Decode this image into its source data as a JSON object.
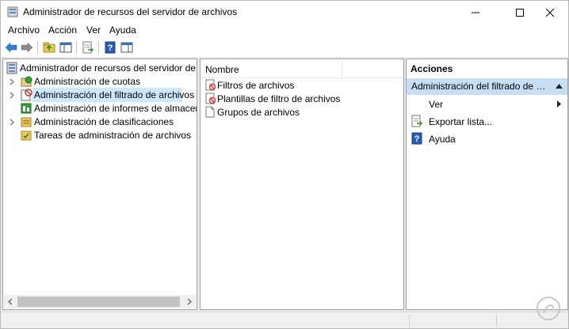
{
  "window": {
    "title": "Administrador de recursos del servidor de archivos",
    "controls": [
      "minimize-icon",
      "maximize-icon",
      "close-icon"
    ]
  },
  "menu": {
    "items": [
      "Archivo",
      "Acción",
      "Ver",
      "Ayuda"
    ]
  },
  "toolbar": {
    "buttons": [
      "back-icon",
      "forward-icon",
      "up-folder-icon",
      "show-hide-tree-icon",
      "export-list-icon",
      "help-icon",
      "show-hide-action-pane-icon"
    ]
  },
  "tree": {
    "root": "Administrador de recursos del servidor de archivos",
    "items": [
      {
        "label": "Administración de cuotas",
        "expandable": true,
        "selected": false
      },
      {
        "label": "Administración del filtrado de archivos",
        "expandable": true,
        "selected": true
      },
      {
        "label": "Administración de informes de almacenamiento",
        "expandable": false,
        "selected": false
      },
      {
        "label": "Administración de clasificaciones",
        "expandable": true,
        "selected": false
      },
      {
        "label": "Tareas de administración de archivos",
        "expandable": false,
        "selected": false
      }
    ]
  },
  "list": {
    "column_header": "Nombre",
    "items": [
      "Filtros de archivos",
      "Plantillas de filtro de archivos",
      "Grupos de archivos"
    ]
  },
  "actions": {
    "header": "Acciones",
    "section_title": "Administración del filtrado de archivos",
    "items": [
      {
        "label": "Ver",
        "has_submenu": true,
        "icon": ""
      },
      {
        "label": "Exportar lista...",
        "has_submenu": false,
        "icon": "export-list-icon"
      },
      {
        "label": "Ayuda",
        "has_submenu": false,
        "icon": "help-icon"
      }
    ]
  },
  "colors": {
    "selection": "#cce8ff",
    "actions_section": "#c6dff5",
    "workarea_bg": "#e9e9e9"
  }
}
